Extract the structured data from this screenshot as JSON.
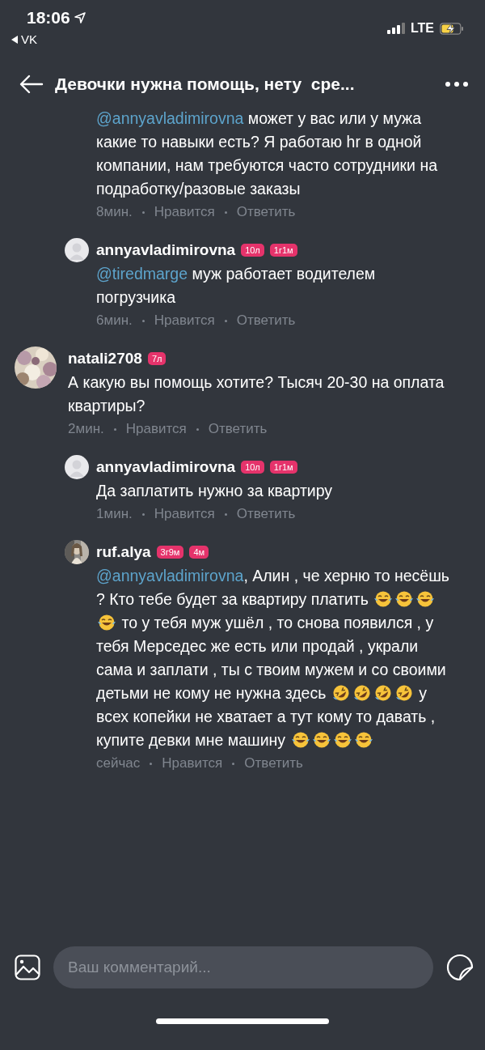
{
  "status_bar": {
    "time": "18:06",
    "back_app": "VK",
    "network": "LTE"
  },
  "header": {
    "title": "Девочки нужна помощь, нету  сре..."
  },
  "replies_continued": [
    {
      "body": [
        {
          "kind": "mention",
          "text": "@annyavladimirovna"
        },
        {
          "kind": "text",
          "text": " может у вас или у мужа какие то навыки есть? Я работаю hr в одной компании, нам требуются часто сотрудники на подработку/разовые заказы"
        }
      ],
      "meta": {
        "time": "8мин.",
        "like": "Нравится",
        "reply": "Ответить"
      }
    },
    {
      "author": "annyavladimirovna",
      "avatar_photo": false,
      "badges": [
        "10л",
        "1г1м"
      ],
      "body": [
        {
          "kind": "mention",
          "text": "@tiredmarge"
        },
        {
          "kind": "text",
          "text": " муж работает водителем погрузчика"
        }
      ],
      "meta": {
        "time": "6мин.",
        "like": "Нравится",
        "reply": "Ответить"
      }
    }
  ],
  "comments": [
    {
      "author": "natali2708",
      "avatar_photo": true,
      "badges": [
        "7л"
      ],
      "body": [
        {
          "kind": "text",
          "text": "А какую вы помощь хотите? Тысяч 20-30 на оплата квартиры?"
        }
      ],
      "meta": {
        "time": "2мин.",
        "like": "Нравится",
        "reply": "Ответить"
      },
      "children": [
        {
          "author": "annyavladimirovna",
          "avatar_photo": false,
          "badges": [
            "10л",
            "1г1м"
          ],
          "body": [
            {
              "kind": "text",
              "text": "Да заплатить нужно за квартиру"
            }
          ],
          "meta": {
            "time": "1мин.",
            "like": "Нравится",
            "reply": "Ответить"
          }
        },
        {
          "author": "ruf.alya",
          "avatar_photo": true,
          "badges": [
            "3г9м",
            "4м"
          ],
          "body": [
            {
              "kind": "mention",
              "text": "@annyavladimirovna"
            },
            {
              "kind": "text",
              "text": ", Алин , че херню то несёшь ? Кто тебе будет за квартиру платить "
            },
            {
              "kind": "joy"
            },
            {
              "kind": "joy"
            },
            {
              "kind": "joy"
            },
            {
              "kind": "joy"
            },
            {
              "kind": "text",
              "text": " то у тебя муж ушёл , то снова появился , у тебя Мерседес же есть или продай , украли сама и заплати , ты с твоим мужем и со своими детьми не кому не нужна здесь "
            },
            {
              "kind": "rofl"
            },
            {
              "kind": "rofl"
            },
            {
              "kind": "rofl"
            },
            {
              "kind": "rofl"
            },
            {
              "kind": "text",
              "text": " у всех копейки не хватает а тут кому то давать , купите девки мне машину "
            },
            {
              "kind": "joy"
            },
            {
              "kind": "joy"
            },
            {
              "kind": "joy"
            },
            {
              "kind": "joy"
            }
          ],
          "meta": {
            "time": "сейчас",
            "like": "Нравится",
            "reply": "Ответить"
          }
        }
      ]
    }
  ],
  "composer": {
    "placeholder": "Ваш комментарий..."
  }
}
